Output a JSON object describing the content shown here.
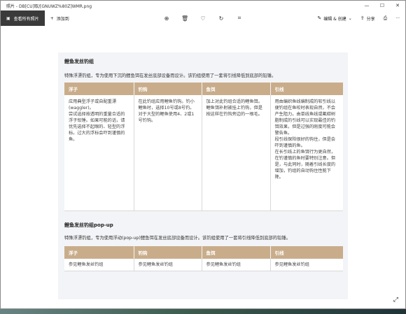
{
  "window": {
    "title": "照片 - DB[CU]取/[GNUWZ%80Z]WMR.png",
    "minimize_glyph": "—",
    "maximize_glyph": "☐",
    "close_glyph": "✕"
  },
  "toolbar": {
    "all_photos_label": "查看所有照片",
    "add_label": "添加到",
    "edit_create_label": "编辑 & 创建",
    "share_label": "分享",
    "more_glyph": "···"
  },
  "doc": {
    "section1": {
      "title": "鲤鱼发丝钓组",
      "intro": "特殊浮漂钓组，专为使用下沉的鲤鱼饵在发丝底部设备而设计。该钓组使用了一套将引线降低到底部的铅锤。",
      "headers": [
        "浮子",
        "钓钩",
        "鱼饵",
        "引线"
      ],
      "cells": [
        [
          "应用典型浮子或自配重漂(waggler)。",
          "尝试选择按透明的重量合适的浮子铅锤。如果可能的话，请优先选择不起眼的、轻型的浮标。过大的浮标会吓到谨慎的鱼。"
        ],
        [
          "在此钓组应用鲤鱼钓钩。钓小鲤鱼时，选择10号或8号钓。对于大型的鲤鱼使用4、2或1号钓钩。"
        ],
        [
          "加上对此钓组合适的鲤鱼饵。",
          "鲤鱼饵补射被挂上钓钩，但是按这样在钓钩旁边的一根毛。"
        ],
        [
          "用由编织鱼线编制成的软引线以便钓组在鱼咬时表现自然，不会产生阻力。由单线鱼线或氟碳树脂制成的引线可以实现最佳的钓饵效果，但是过强的刚度可能会警告鱼。",
          "段引线保险很好的钩住，但是会吓到谨慎的鱼。",
          "在长引线上的鱼饵行为更自然，在钓谨慎的鱼时要特别注意。但是，与此同时，随着引线长度的增加，钓组的自动钩住性能下降。"
        ]
      ]
    },
    "section2": {
      "title": "鲤鱼发丝钓组pop-up",
      "intro": "特殊浮漂钓组，专为使用浮动(pop-up)鲤鱼饵在发丝底部设备而设计。该钓组使用了一套将引线降低到底部的铅锤。",
      "headers": [
        "浮子",
        "钓钩",
        "鱼饵",
        "引线"
      ],
      "cells": [
        "参见鲤鱼发丝钓组",
        "参见鲤鱼发丝钓组",
        "参见鲤鱼发丝钓组",
        "参见鲤鱼发丝钓组"
      ]
    }
  }
}
